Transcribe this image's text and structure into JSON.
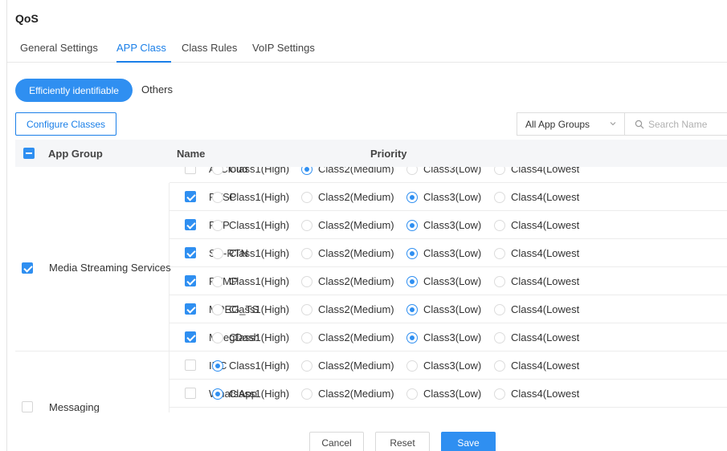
{
  "page": {
    "title": "QoS"
  },
  "tabs": [
    {
      "label": "General Settings",
      "active": false
    },
    {
      "label": "APP Class",
      "active": true
    },
    {
      "label": "Class Rules",
      "active": false
    },
    {
      "label": "VoIP Settings",
      "active": false
    }
  ],
  "segment": {
    "active": "Efficiently identifiable",
    "other": "Others"
  },
  "toolbar": {
    "configure_label": "Configure Classes",
    "app_group_select": "All App Groups",
    "search_placeholder": "Search Name"
  },
  "table": {
    "headers": {
      "app_group": "App Group",
      "name": "Name",
      "priority": "Priority"
    },
    "priority_options": [
      "Class1(High)",
      "Class2(Medium)",
      "Class3(Low)",
      "Class4(Lowest"
    ],
    "rows": [
      {
        "group": "",
        "name": "AliCloud",
        "checked": false,
        "priority": 1
      },
      {
        "group": "Media Streaming Services",
        "name": "RTSP",
        "checked": true,
        "priority": 2
      },
      {
        "group": "Media Streaming Services",
        "name": "RTP",
        "checked": true,
        "priority": 2
      },
      {
        "group": "Media Streaming Services",
        "name": "SD-RTN",
        "checked": true,
        "priority": 2
      },
      {
        "group": "Media Streaming Services",
        "name": "RTMP",
        "checked": true,
        "priority": 2
      },
      {
        "group": "Media Streaming Services",
        "name": "MPEG_TS",
        "checked": true,
        "priority": 2
      },
      {
        "group": "Media Streaming Services",
        "name": "MpegDash",
        "checked": true,
        "priority": 2
      },
      {
        "group": "Messaging",
        "name": "IRC",
        "checked": false,
        "priority": 0
      },
      {
        "group": "Messaging",
        "name": "WhatsApp",
        "checked": false,
        "priority": 0
      }
    ],
    "groups": [
      {
        "label": "Media Streaming Services",
        "checked": true
      },
      {
        "label": "Messaging",
        "checked": false
      }
    ]
  },
  "footer": {
    "cancel": "Cancel",
    "reset": "Reset",
    "save": "Save"
  },
  "colors": {
    "accent": "#2f8ff1",
    "header_bg": "#f5f6f8",
    "border": "#ececec"
  },
  "icons": {
    "search": "search-icon",
    "chevron": "chevron-down-icon",
    "checkbox": "checkbox-icon"
  }
}
